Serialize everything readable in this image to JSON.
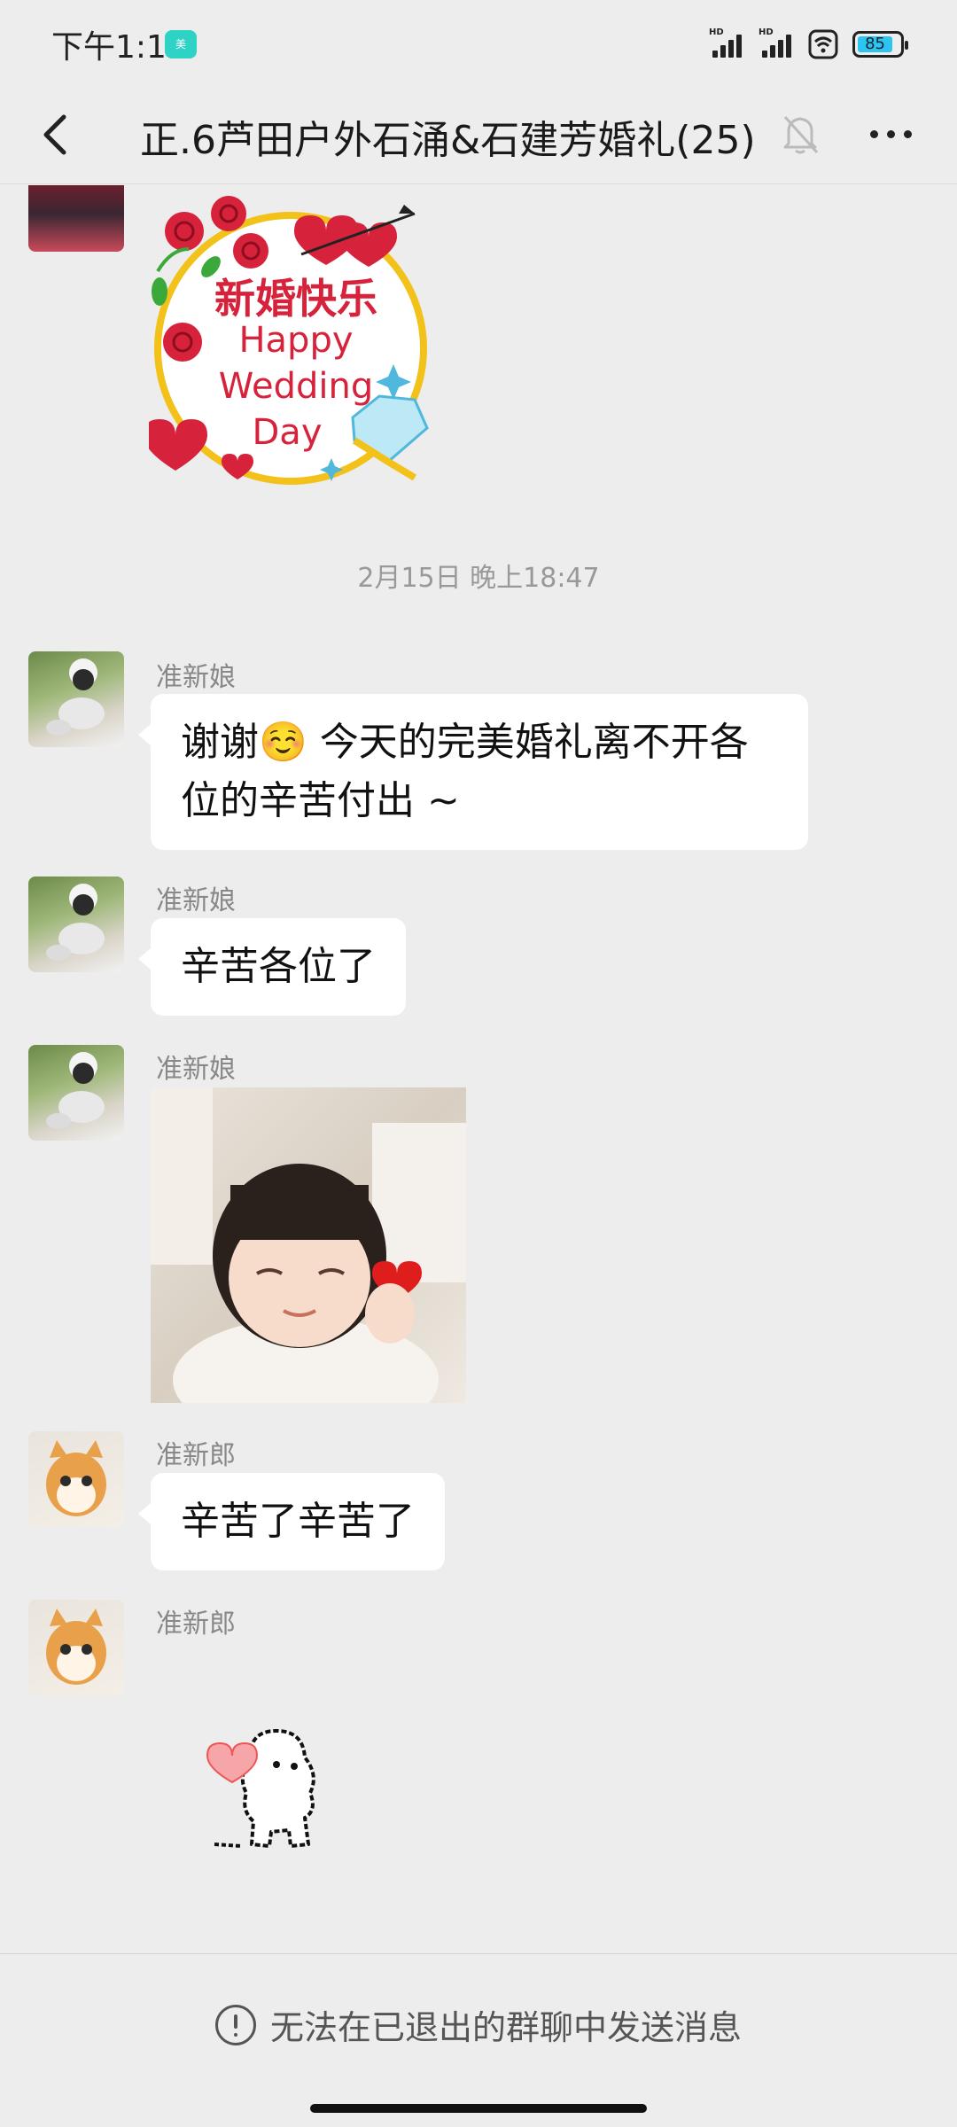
{
  "status_bar": {
    "time": "下午1:11",
    "app_icon_label": "美",
    "battery": "85"
  },
  "nav": {
    "title": "正.6芦田户外石涌&石建芳婚礼(25)"
  },
  "chat": {
    "timestamp": "2月15日 晚上18:47",
    "messages": [
      {
        "sender": "准新娘",
        "text": "谢谢☺️ 今天的完美婚礼离不开各位的辛苦付出 ~"
      },
      {
        "sender": "准新娘",
        "text": "辛苦各位了"
      },
      {
        "sender": "准新娘"
      },
      {
        "sender": "准新郎",
        "text": "辛苦了辛苦了"
      },
      {
        "sender": "准新郎"
      }
    ],
    "sticker_wedding": {
      "line1": "新婚快乐",
      "line2": "Happy",
      "line3": "Wedding",
      "line4": "Day"
    }
  },
  "bottom": {
    "notice": "无法在已退出的群聊中发送消息"
  },
  "colors": {
    "background": "#ededed",
    "bubble": "#ffffff",
    "battery_fill": "#2ec4f0",
    "sticker_red": "#d6223a",
    "sticker_gold": "#f2c21b"
  }
}
